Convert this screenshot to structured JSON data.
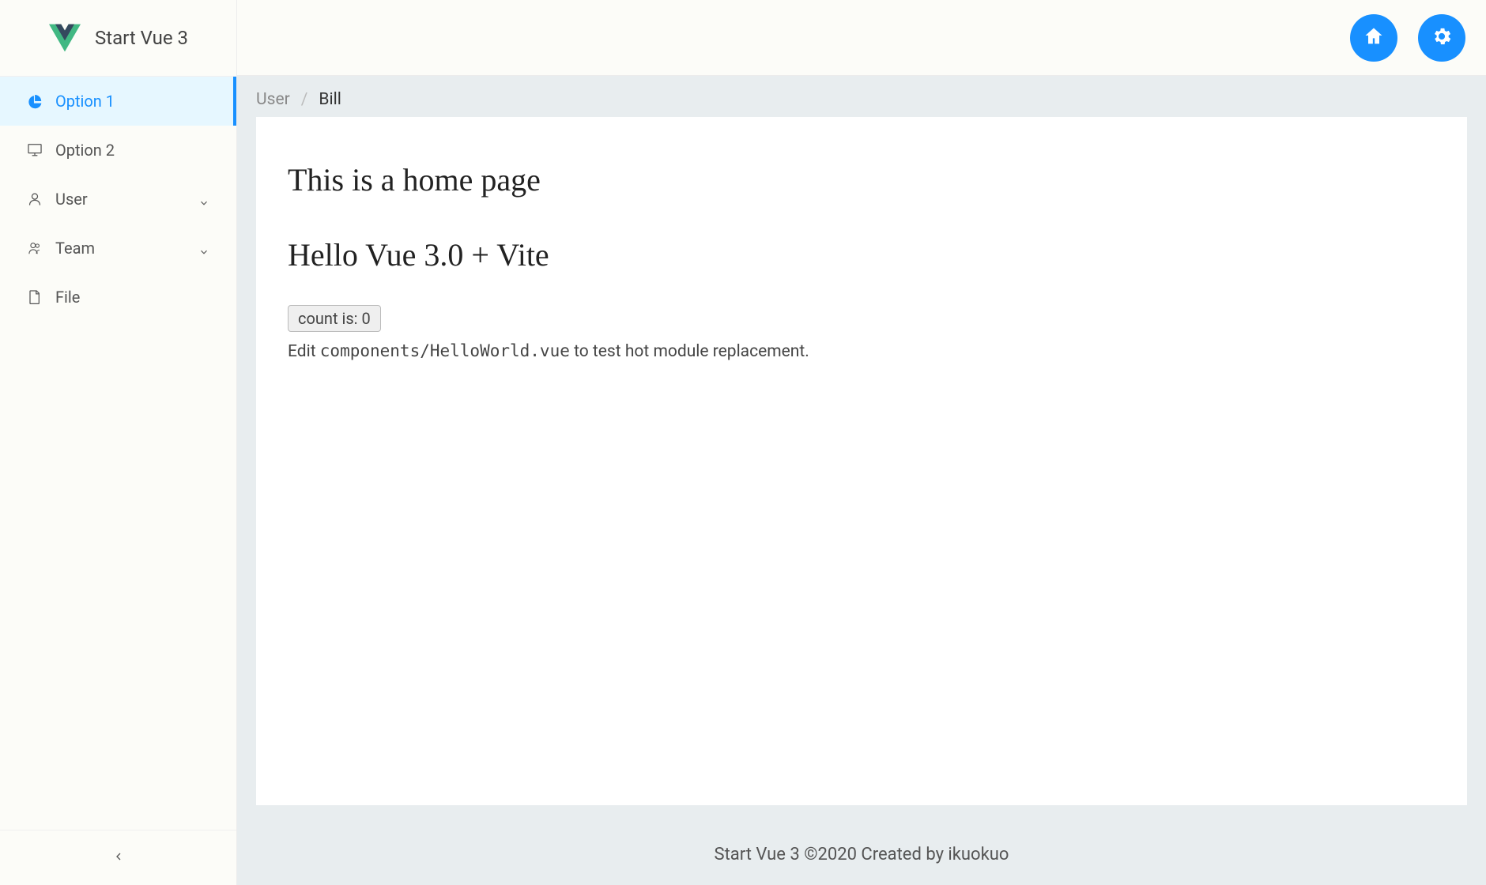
{
  "app": {
    "title": "Start Vue 3"
  },
  "sidebar": {
    "items": [
      {
        "label": "Option 1",
        "icon": "pie-chart-icon",
        "active": true,
        "expandable": false
      },
      {
        "label": "Option 2",
        "icon": "desktop-icon",
        "active": false,
        "expandable": false
      },
      {
        "label": "User",
        "icon": "user-icon",
        "active": false,
        "expandable": true
      },
      {
        "label": "Team",
        "icon": "team-icon",
        "active": false,
        "expandable": true
      },
      {
        "label": "File",
        "icon": "file-icon",
        "active": false,
        "expandable": false
      }
    ]
  },
  "breadcrumb": {
    "items": [
      "User",
      "Bill"
    ]
  },
  "main": {
    "heading1": "This is a home page",
    "heading2": "Hello Vue 3.0 + Vite",
    "count_label": "count is: 0",
    "hint_prefix": "Edit ",
    "hint_code": "components/HelloWorld.vue",
    "hint_suffix": " to test hot module replacement."
  },
  "footer": {
    "text": "Start Vue 3 ©2020 Created by ikuokuo"
  }
}
